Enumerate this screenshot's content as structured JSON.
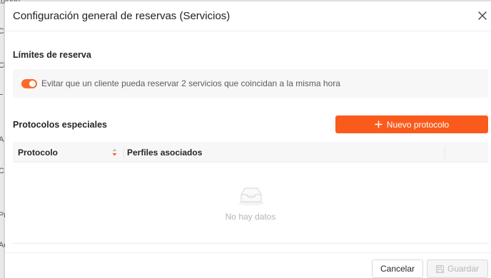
{
  "background": {
    "fragments": [
      "tolodo",
      "C",
      "Ci",
      "L",
      "A",
      "C",
      "Pr",
      "Ac"
    ]
  },
  "modal": {
    "title": "Configuración general de reservas (Servicios)",
    "close_icon": "close-icon"
  },
  "limits": {
    "heading": "Límites de reserva",
    "toggle_on": true,
    "toggle_label": "Evitar que un cliente pueda reservar 2 servicios que coincidan a la misma hora"
  },
  "protocols": {
    "heading": "Protocolos especiales",
    "new_button_label": "Nuevo protocolo",
    "new_button_icon": "plus-icon",
    "columns": [
      "Protocolo",
      "Perfiles asociados"
    ],
    "rows": [],
    "empty_text": "No hay datos",
    "empty_icon": "empty-inbox-icon"
  },
  "footer": {
    "cancel_label": "Cancelar",
    "save_label": "Guardar",
    "save_icon": "save-icon",
    "save_disabled": true
  },
  "colors": {
    "accent": "#fa5b1c",
    "toggle_active": "#fa6a2a"
  }
}
